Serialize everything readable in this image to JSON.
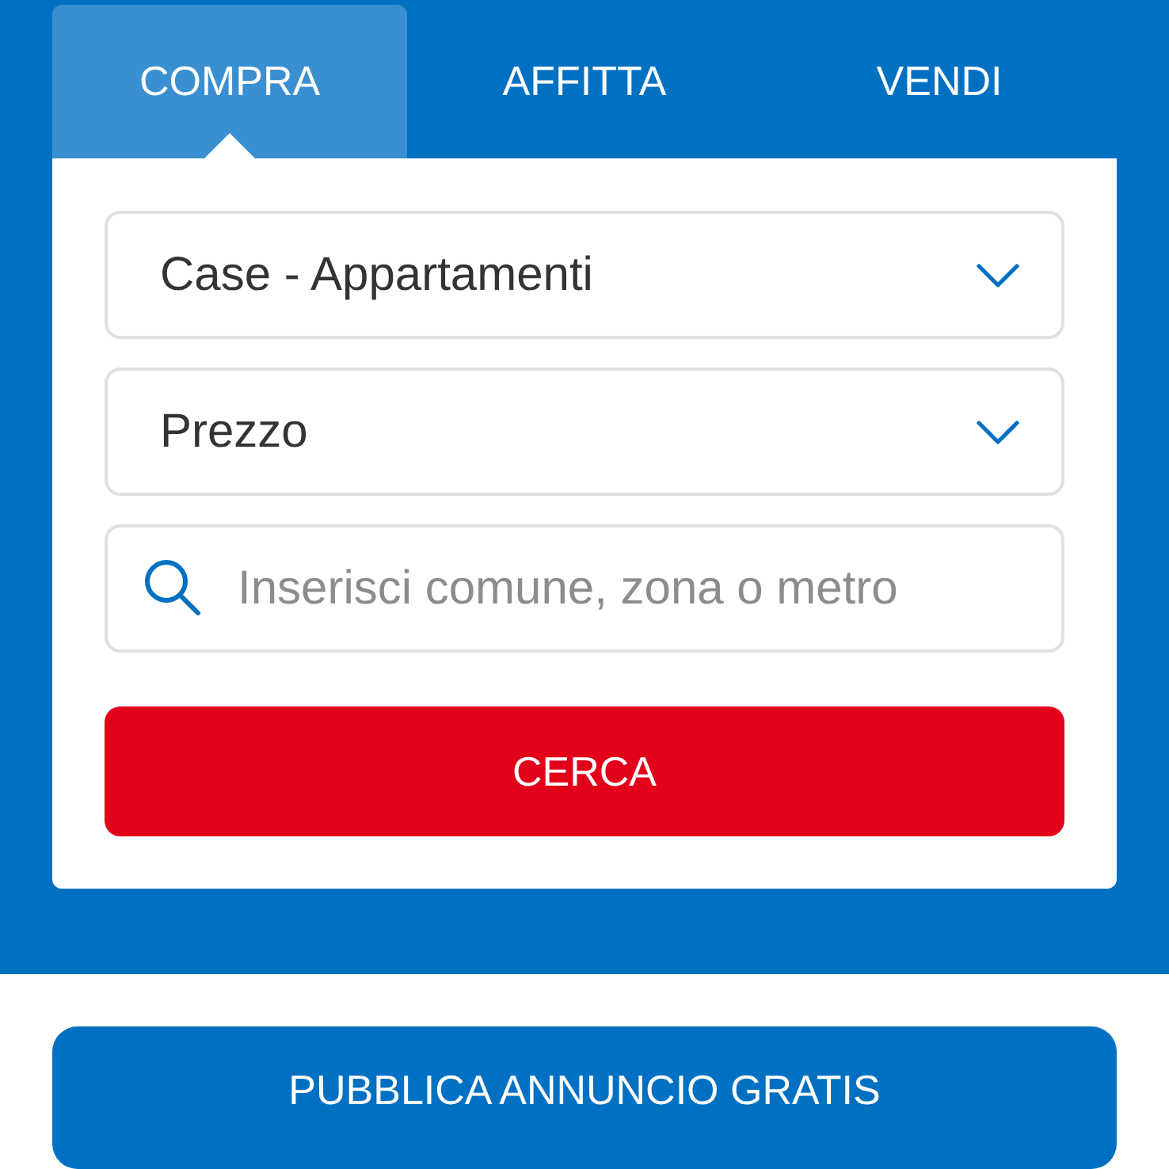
{
  "tabs": [
    {
      "label": "COMPRA",
      "selected": true
    },
    {
      "label": "AFFITTA",
      "selected": false
    },
    {
      "label": "VENDI",
      "selected": false
    }
  ],
  "filters": [
    {
      "kind": "select",
      "value": "Case - Appartamenti"
    },
    {
      "kind": "select",
      "value": "Prezzo"
    },
    {
      "kind": "search",
      "placeholder": "Inserisci comune, zona o metro"
    }
  ],
  "search_button": "CERCA",
  "publish_button": "PUBBLICA ANNUNCIO GRATIS"
}
